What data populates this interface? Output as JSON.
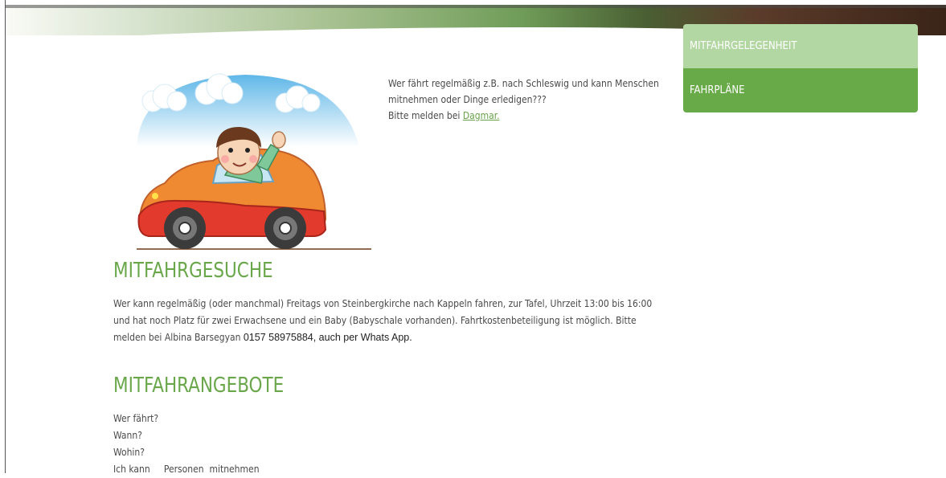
{
  "sidebar": {
    "items": [
      {
        "label": "MITFAHRGELEGENHEIT"
      },
      {
        "label": "FAHRPLÄNE"
      }
    ]
  },
  "intro": {
    "line1": "Wer fährt regelmäßig z.B. nach Schleswig und kann Menschen",
    "line2": "mitnehmen oder Dinge erledigen???",
    "line3_prefix": "Bitte melden bei ",
    "line3_link": "Dagmar."
  },
  "gesuche": {
    "heading": "MITFAHRGESUCHE",
    "text": "Wer kann regelmäßig (oder manchmal) Freitags von Steinbergkirche  nach Kappeln fahren, zur Tafel, Uhrzeit 13:00 bis 16:00 und hat noch Platz für zwei Erwachsene und ein Baby (Babyschale vorhanden). Fahrtkostenbeteiligung ist möglich. Bitte melden bei Albina Barsegyan ",
    "phone": "0157 58975884, auch per Whats App."
  },
  "angebote": {
    "heading": "MITFAHRANGEBOTE",
    "lines": [
      "Wer fährt?",
      "Wann?",
      "Wohin?",
      "Ich kann     Personen  mitnehmen"
    ]
  },
  "colors": {
    "accent_green": "#69aa48",
    "light_green": "#b3d7a2",
    "heading_green": "#69a74a"
  },
  "icons": [
    "car-illustration"
  ]
}
